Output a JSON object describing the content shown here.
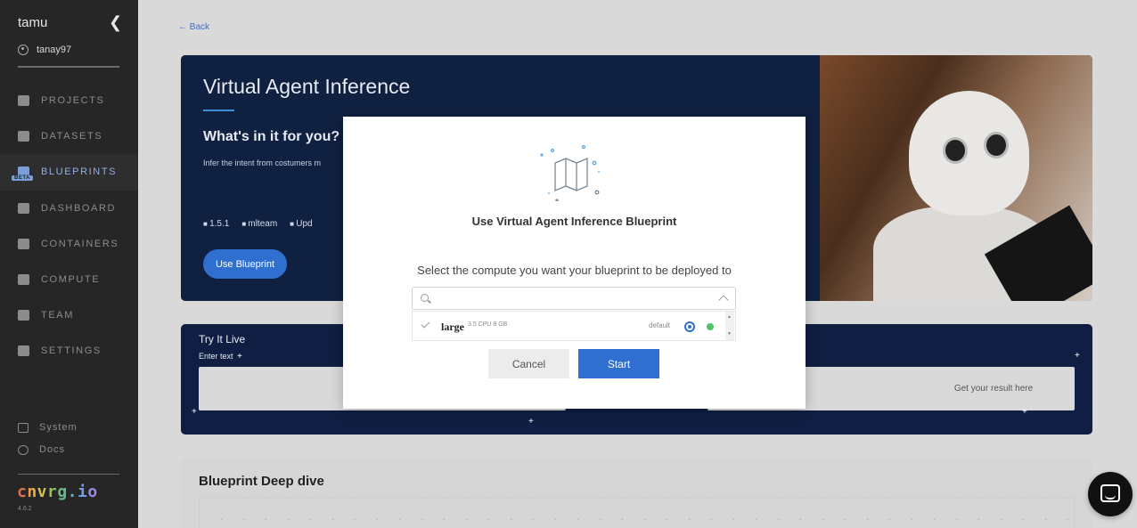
{
  "sidebar": {
    "org": "tamu",
    "user": "tanay97",
    "nav": [
      {
        "label": "PROJECTS",
        "icon": "projects-icon"
      },
      {
        "label": "DATASETS",
        "icon": "datasets-icon"
      },
      {
        "label": "BLUEPRINTS",
        "icon": "blueprints-icon",
        "active": true,
        "badge": "BETA"
      },
      {
        "label": "DASHBOARD",
        "icon": "dashboard-icon"
      },
      {
        "label": "CONTAINERS",
        "icon": "containers-icon"
      },
      {
        "label": "COMPUTE",
        "icon": "compute-icon"
      },
      {
        "label": "TEAM",
        "icon": "team-icon"
      },
      {
        "label": "SETTINGS",
        "icon": "settings-icon"
      }
    ],
    "system": "System",
    "docs": "Docs",
    "logo": "cnvrg.io",
    "version": "4.6.2"
  },
  "page": {
    "back": "Back",
    "hero": {
      "title": "Virtual Agent Inference",
      "subtitle": "What's in it for you?",
      "description": "Infer the intent from costumers m",
      "version": "1.5.1",
      "author": "mlteam",
      "updated": "Upd",
      "button": "Use Blueprint"
    },
    "try_live": {
      "title": "Try It Live",
      "input_label": "Enter text",
      "input_placeholder_partial": "E",
      "result": "Get your result here"
    },
    "deep_dive": {
      "title": "Blueprint Deep dive"
    }
  },
  "modal": {
    "title": "Use Virtual Agent Inference Blueprint",
    "description": "Select the compute you want your blueprint to be deployed to",
    "option": {
      "name": "large",
      "spec": "3.5 CPU 8 GB",
      "tag": "default"
    },
    "cancel": "Cancel",
    "start": "Start"
  },
  "colors": {
    "accent": "#2f6fd0",
    "hero_bg": "#102041",
    "sidebar_bg": "#262626",
    "status_green": "#4cc46a"
  }
}
